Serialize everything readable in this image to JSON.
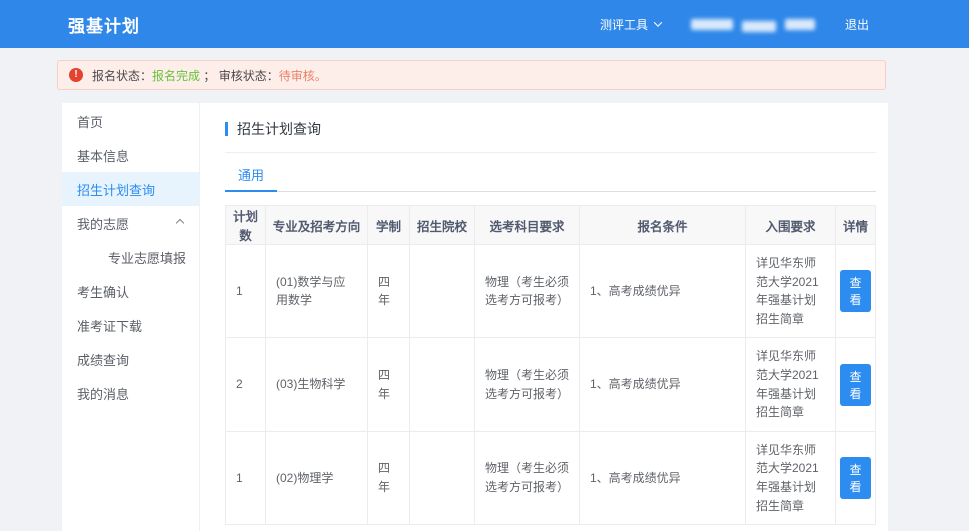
{
  "colors": {
    "accent": "#2d8cf0",
    "header-bg": "#2e87e9",
    "page-bg": "#f0f2f5",
    "active-bg": "#e7f4fd",
    "alert-bg": "#fdeeea",
    "alert-border": "#f6d0c4",
    "alert-icon": "#e3422f",
    "success": "#67c23a",
    "pending": "#ea826a"
  },
  "header": {
    "title": "强基计划",
    "tool_menu": "测评工具",
    "logout": "退出"
  },
  "alert": {
    "icon": "exclamation-circle-icon",
    "icon_glyph": "!",
    "label_1": "报名状态：",
    "value_1": "报名完成",
    "separator": "；",
    "label_2": "审核状态：",
    "value_2": "待审核。"
  },
  "sidebar": {
    "items": [
      {
        "label": "首页",
        "active": false,
        "sub": false,
        "expandable": false
      },
      {
        "label": "基本信息",
        "active": false,
        "sub": false,
        "expandable": false
      },
      {
        "label": "招生计划查询",
        "active": true,
        "sub": false,
        "expandable": false
      },
      {
        "label": "我的志愿",
        "active": false,
        "sub": false,
        "expandable": true
      },
      {
        "label": "专业志愿填报",
        "active": false,
        "sub": true,
        "expandable": false
      },
      {
        "label": "考生确认",
        "active": false,
        "sub": false,
        "expandable": false
      },
      {
        "label": "准考证下载",
        "active": false,
        "sub": false,
        "expandable": false
      },
      {
        "label": "成绩查询",
        "active": false,
        "sub": false,
        "expandable": false
      },
      {
        "label": "我的消息",
        "active": false,
        "sub": false,
        "expandable": false
      }
    ]
  },
  "main": {
    "page_title": "招生计划查询",
    "active_tab": "通用",
    "table": {
      "headers": [
        "计划数",
        "专业及招考方向",
        "学制",
        "招生院校",
        "选考科目要求",
        "报名条件",
        "入围要求",
        "详情"
      ],
      "rows": [
        {
          "plan_count": "1",
          "major": "(01)数学与应用数学",
          "duration": "四年",
          "college": "",
          "subject_req": "物理（考生必须选考方可报考）",
          "apply_cond": "1、高考成绩优异",
          "shortlist_req": "详见华东师范大学2021年强基计划招生简章",
          "action": "查看"
        },
        {
          "plan_count": "2",
          "major": "(03)生物科学",
          "duration": "四年",
          "college": "",
          "subject_req": "物理（考生必须选考方可报考）",
          "apply_cond": "1、高考成绩优异",
          "shortlist_req": "详见华东师范大学2021年强基计划招生简章",
          "action": "查看"
        },
        {
          "plan_count": "1",
          "major": "(02)物理学",
          "duration": "四年",
          "college": "",
          "subject_req": "物理（考生必须选考方可报考）",
          "apply_cond": "1、高考成绩优异",
          "shortlist_req": "详见华东师范大学2021年强基计划招生简章",
          "action": "查看"
        }
      ]
    }
  }
}
